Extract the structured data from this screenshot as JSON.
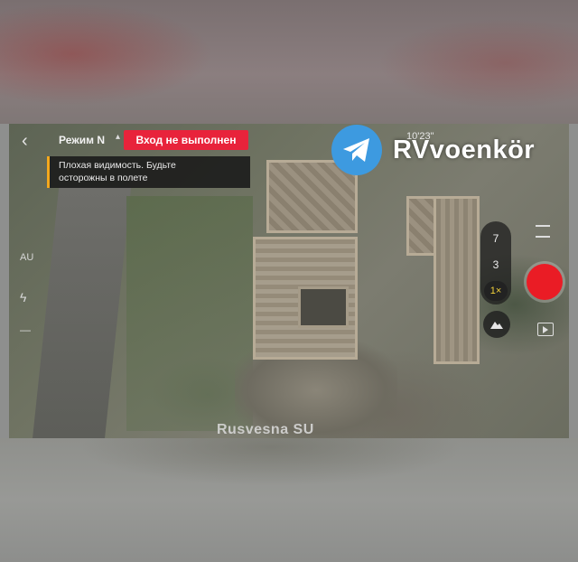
{
  "watermark": {
    "channel": "RVvoenkör",
    "source": "Rusvesna SU"
  },
  "drone_ui": {
    "back_icon": "chevron-left-icon",
    "mode_label": "Режим N",
    "login_status": "Вход не выполнен",
    "warning_line1": "Плохая видимость. Будьте",
    "warning_line2": "осторожны в полете",
    "status_time": "10'23\"",
    "zoom_levels": [
      "7",
      "3",
      "1×"
    ],
    "left_icon_text": "AU",
    "colors": {
      "login_badge": "#e8233b",
      "warning_accent": "#f4a81d",
      "shutter": "#ea1c25",
      "telegram": "#3d9ae0"
    }
  }
}
